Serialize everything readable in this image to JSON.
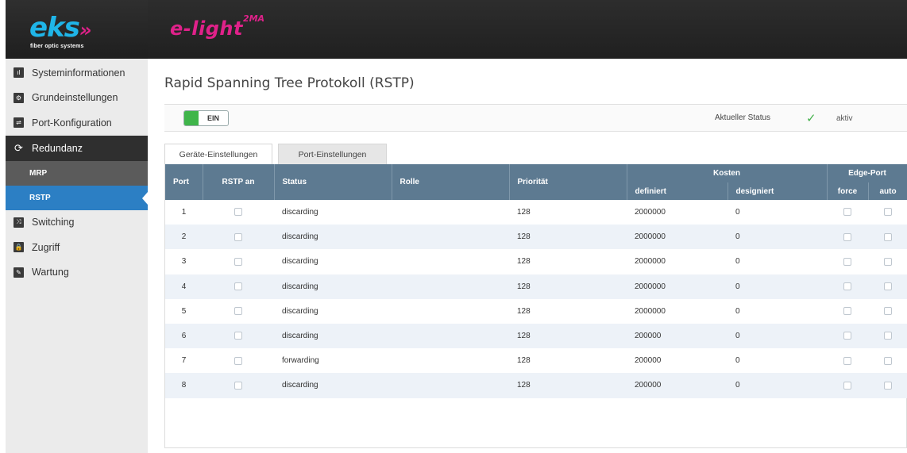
{
  "brand": {
    "logo_text": "eks",
    "logo_arrows": "»",
    "logo_tagline": "fiber optic systems",
    "product_name": "e-light",
    "product_suffix": "2MA"
  },
  "sidebar": {
    "items": [
      {
        "label": "Systeminformationen",
        "icon": "chart-icon",
        "glyph": "ıl"
      },
      {
        "label": "Grundeinstellungen",
        "icon": "gear-icon",
        "glyph": "⚙"
      },
      {
        "label": "Port-Konfiguration",
        "icon": "port-icon",
        "glyph": "⇌"
      },
      {
        "label": "Redundanz",
        "icon": "redundancy-icon",
        "glyph": "⟳"
      },
      {
        "label": "Switching",
        "icon": "switching-icon",
        "glyph": "⤨"
      },
      {
        "label": "Zugriff",
        "icon": "lock-icon",
        "glyph": "🔒"
      },
      {
        "label": "Wartung",
        "icon": "wrench-icon",
        "glyph": "✎"
      }
    ],
    "sub_items": [
      {
        "label": "MRP"
      },
      {
        "label": "RSTP"
      }
    ]
  },
  "page": {
    "title": "Rapid Spanning Tree Protokoll (RSTP)"
  },
  "status_bar": {
    "toggle_label": "EIN",
    "toggle_on": true,
    "status_label": "Aktueller Status",
    "status_value": "aktiv",
    "status_color": "#43b14a"
  },
  "tabs": [
    {
      "label": "Geräte-Einstellungen"
    },
    {
      "label": "Port-Einstellungen"
    }
  ],
  "table": {
    "headers": {
      "port": "Port",
      "rstp_an": "RSTP an",
      "status": "Status",
      "rolle": "Rolle",
      "prioritaet": "Priorität",
      "kosten": "Kosten",
      "definiert": "definiert",
      "designiert": "designiert",
      "edge_port": "Edge-Port",
      "force": "force",
      "auto": "auto"
    },
    "rows": [
      {
        "port": "1",
        "status": "discarding",
        "rolle": "",
        "prioritaet": "128",
        "definiert": "2000000",
        "designiert": "0"
      },
      {
        "port": "2",
        "status": "discarding",
        "rolle": "",
        "prioritaet": "128",
        "definiert": "2000000",
        "designiert": "0"
      },
      {
        "port": "3",
        "status": "discarding",
        "rolle": "",
        "prioritaet": "128",
        "definiert": "2000000",
        "designiert": "0"
      },
      {
        "port": "4",
        "status": "discarding",
        "rolle": "",
        "prioritaet": "128",
        "definiert": "2000000",
        "designiert": "0"
      },
      {
        "port": "5",
        "status": "discarding",
        "rolle": "",
        "prioritaet": "128",
        "definiert": "2000000",
        "designiert": "0"
      },
      {
        "port": "6",
        "status": "discarding",
        "rolle": "",
        "prioritaet": "128",
        "definiert": "200000",
        "designiert": "0"
      },
      {
        "port": "7",
        "status": "forwarding",
        "rolle": "",
        "prioritaet": "128",
        "definiert": "200000",
        "designiert": "0"
      },
      {
        "port": "8",
        "status": "discarding",
        "rolle": "",
        "prioritaet": "128",
        "definiert": "200000",
        "designiert": "0"
      }
    ]
  }
}
